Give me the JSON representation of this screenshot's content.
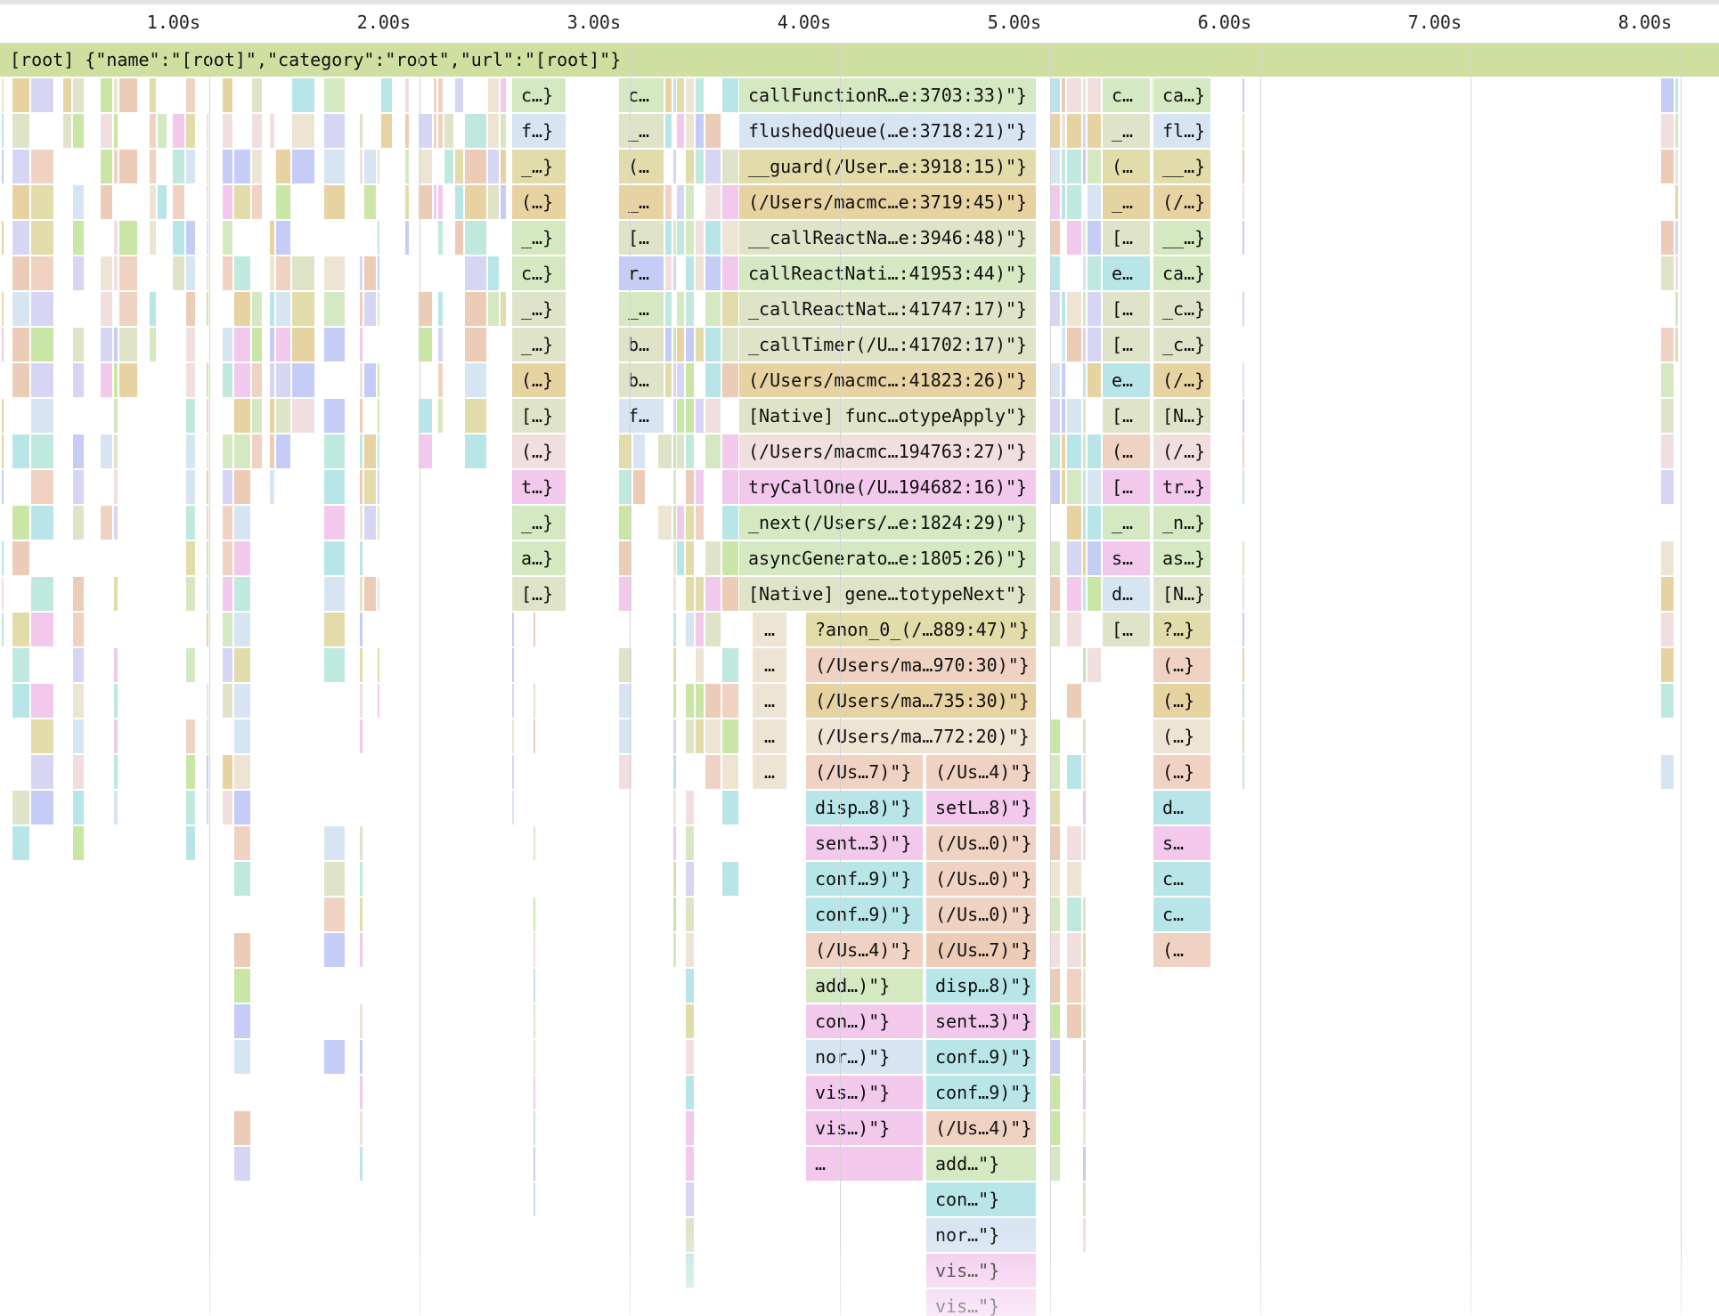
{
  "colors": {
    "root": "#cfdfa0",
    "green": "#d4e8c2",
    "sage": "#dfe4c8",
    "olive": "#e2dcaa",
    "tan": "#e7d2a2",
    "peach": "#efd2c2",
    "salmon": "#eccbb7",
    "pink": "#f1dede",
    "magenta": "#f2c8ec",
    "lavender": "#d6d6f4",
    "periwinkle": "#c5ccf6",
    "lightblue": "#d7e4f2",
    "cyan": "#b8e6e8",
    "sand": "#eee4d4",
    "lime": "#c9e6a7",
    "teal": "#bfe8de"
  },
  "ruler": {
    "ticks": [
      "1.00s",
      "2.00s",
      "3.00s",
      "4.00s",
      "5.00s",
      "6.00s",
      "7.00s",
      "8.00s"
    ]
  },
  "flamechart": {
    "root_label": "[root] {\"name\":\"[root]\",\"category\":\"root\",\"url\":\"[root]\"}",
    "stack": [
      {
        "label": "callFunctionR…e:3703:33)\"}",
        "c1": "green"
      },
      {
        "label": "flushedQueue(…e:3718:21)\"}",
        "c1": "lightblue"
      },
      {
        "label": "__guard(/User…e:3918:15)\"}",
        "c1": "olive"
      },
      {
        "label": "(/Users/macmc…e:3719:45)\"}",
        "c1": "tan"
      },
      {
        "label": "__callReactNa…e:3946:48)\"}",
        "c1": "sage"
      },
      {
        "label": "callReactNati…:41953:44)\"}",
        "c1": "green"
      },
      {
        "label": "_callReactNat…:41747:17)\"}",
        "c1": "sage"
      },
      {
        "label": "_callTimer(/U…:41702:17)\"}",
        "c1": "sage"
      },
      {
        "label": "(/Users/macmc…:41823:26)\"}",
        "c1": "tan"
      },
      {
        "label": "[Native] func…otypeApply\"}",
        "c1": "sage"
      },
      {
        "label": "(/Users/macmc…194763:27)\"}",
        "c1": "pink"
      },
      {
        "label": "tryCallOne(/U…194682:16)\"}",
        "c1": "magenta"
      },
      {
        "label": "_next(/Users/…e:1824:29)\"}",
        "c1": "green"
      },
      {
        "label": "asyncGenerato…e:1805:26)\"}",
        "c1": "green"
      },
      {
        "label": "[Native] gene…totypeNext\"}",
        "c1": "sage"
      },
      {
        "label": "?anon_0_(/…889:47)\"}",
        "c1": "olive"
      },
      {
        "label": "(/Users/ma…970:30)\"}",
        "c1": "peach"
      },
      {
        "label": "(/Users/ma…735:30)\"}",
        "c1": "tan"
      },
      {
        "label": "(/Users/ma…772:20)\"}",
        "c1": "sand"
      },
      {
        "label": "(/Us…7)\"}",
        "c1": "peach",
        "label2": "(/Us…4)\"}",
        "c2": "peach"
      },
      {
        "label": "disp…8)\"}",
        "c1": "cyan",
        "label2": "setL…8)\"}",
        "c2": "magenta"
      },
      {
        "label": "sent…3)\"}",
        "c1": "magenta",
        "label2": "(/Us…0)\"}",
        "c2": "peach"
      },
      {
        "label": "conf…9)\"}",
        "c1": "cyan",
        "label2": "(/Us…0)\"}",
        "c2": "peach"
      },
      {
        "label": "conf…9)\"}",
        "c1": "cyan",
        "label2": "(/Us…0)\"}",
        "c2": "peach"
      },
      {
        "label": "(/Us…4)\"}",
        "c1": "peach",
        "label2": "(/Us…7)\"}",
        "c2": "salmon"
      },
      {
        "label": "add…)\"}",
        "c1": "green",
        "label2": "disp…8)\"}",
        "c2": "cyan"
      },
      {
        "label": "con…)\"}",
        "c1": "magenta",
        "label2": "sent…3)\"}",
        "c2": "magenta"
      },
      {
        "label": "nor…)\"}",
        "c1": "lightblue",
        "label2": "conf…9)\"}",
        "c2": "cyan"
      },
      {
        "label": "vis…)\"}",
        "c1": "magenta",
        "label2": "conf…9)\"}",
        "c2": "cyan"
      },
      {
        "label": "vis…)\"}",
        "c1": "magenta",
        "label2": "(/Us…4)\"}",
        "c2": "peach"
      },
      {
        "label": "…",
        "c1": "magenta",
        "label2": "add…\"}",
        "c2": "green"
      },
      {
        "label": "",
        "c1": "",
        "label2": "con…\"}",
        "c2": "cyan"
      },
      {
        "label": "",
        "c1": "",
        "label2": "nor…\"}",
        "c2": "lightblue"
      },
      {
        "label": "",
        "c1": "",
        "label2": "vis…\"}",
        "c2": "magenta"
      },
      {
        "label": "",
        "c1": "",
        "label2": "vis…\"}",
        "c2": "magenta"
      }
    ],
    "col_a": [
      {
        "t": "c…}",
        "c": "green"
      },
      {
        "t": "f…}",
        "c": "lightblue"
      },
      {
        "t": "_…}",
        "c": "olive"
      },
      {
        "t": "(…}",
        "c": "tan"
      },
      {
        "t": "_…}",
        "c": "green"
      },
      {
        "t": "c…}",
        "c": "green"
      },
      {
        "t": "_…}",
        "c": "sage"
      },
      {
        "t": "_…}",
        "c": "sage"
      },
      {
        "t": "(…}",
        "c": "tan"
      },
      {
        "t": "[…}",
        "c": "sage"
      },
      {
        "t": "(…}",
        "c": "pink"
      },
      {
        "t": "t…}",
        "c": "magenta"
      },
      {
        "t": "_…}",
        "c": "green"
      },
      {
        "t": "a…}",
        "c": "green"
      },
      {
        "t": "[…}",
        "c": "sage"
      }
    ],
    "col_b": [
      {
        "t": "c…",
        "c": "green"
      },
      {
        "t": "_…",
        "c": "sage"
      },
      {
        "t": "(…",
        "c": "olive"
      },
      {
        "t": "_…",
        "c": "tan"
      },
      {
        "t": "[…",
        "c": "sage"
      },
      {
        "t": "r…",
        "c": "periwinkle"
      },
      {
        "t": "_…",
        "c": "green"
      },
      {
        "t": "b…",
        "c": "sage"
      },
      {
        "t": "b…",
        "c": "sage"
      },
      {
        "t": "f…",
        "c": "lightblue"
      }
    ],
    "col_c": [
      {
        "t": "c…",
        "c": "green"
      },
      {
        "t": "_…",
        "c": "sage"
      },
      {
        "t": "(…",
        "c": "olive"
      },
      {
        "t": "_…",
        "c": "tan"
      },
      {
        "t": "[…",
        "c": "sage"
      },
      {
        "t": "e…",
        "c": "cyan"
      },
      {
        "t": "[…",
        "c": "sage"
      },
      {
        "t": "[…",
        "c": "sage"
      },
      {
        "t": "e…",
        "c": "cyan"
      },
      {
        "t": "[…",
        "c": "sage"
      },
      {
        "t": "(…",
        "c": "peach"
      },
      {
        "t": "[…",
        "c": "magenta"
      },
      {
        "t": "_…",
        "c": "green"
      },
      {
        "t": "s…",
        "c": "magenta"
      },
      {
        "t": "d…",
        "c": "lightblue"
      },
      {
        "t": "[…",
        "c": "sage"
      }
    ],
    "col_d": [
      {
        "t": "ca…}",
        "c": "green"
      },
      {
        "t": "fl…}",
        "c": "lightblue"
      },
      {
        "t": "__…}",
        "c": "olive"
      },
      {
        "t": "(/…}",
        "c": "tan"
      },
      {
        "t": "__…}",
        "c": "green"
      },
      {
        "t": "ca…}",
        "c": "green"
      },
      {
        "t": "_c…}",
        "c": "sage"
      },
      {
        "t": "_c…}",
        "c": "sage"
      },
      {
        "t": "(/…}",
        "c": "tan"
      },
      {
        "t": "[N…}",
        "c": "sage"
      },
      {
        "t": "(/…}",
        "c": "pink"
      },
      {
        "t": "tr…}",
        "c": "magenta"
      },
      {
        "t": "_n…}",
        "c": "green"
      },
      {
        "t": "as…}",
        "c": "green"
      },
      {
        "t": "[N…}",
        "c": "sage"
      },
      {
        "t": "?…}",
        "c": "olive"
      },
      {
        "t": "(…}",
        "c": "peach"
      },
      {
        "t": "(…}",
        "c": "tan"
      },
      {
        "t": "(…}",
        "c": "sand"
      },
      {
        "t": "(…}",
        "c": "peach"
      },
      {
        "t": "d…",
        "c": "cyan"
      },
      {
        "t": "s…",
        "c": "magenta"
      },
      {
        "t": "c…",
        "c": "cyan"
      },
      {
        "t": "c…",
        "c": "cyan"
      },
      {
        "t": "(…",
        "c": "peach"
      }
    ],
    "ellipsis": "…"
  }
}
